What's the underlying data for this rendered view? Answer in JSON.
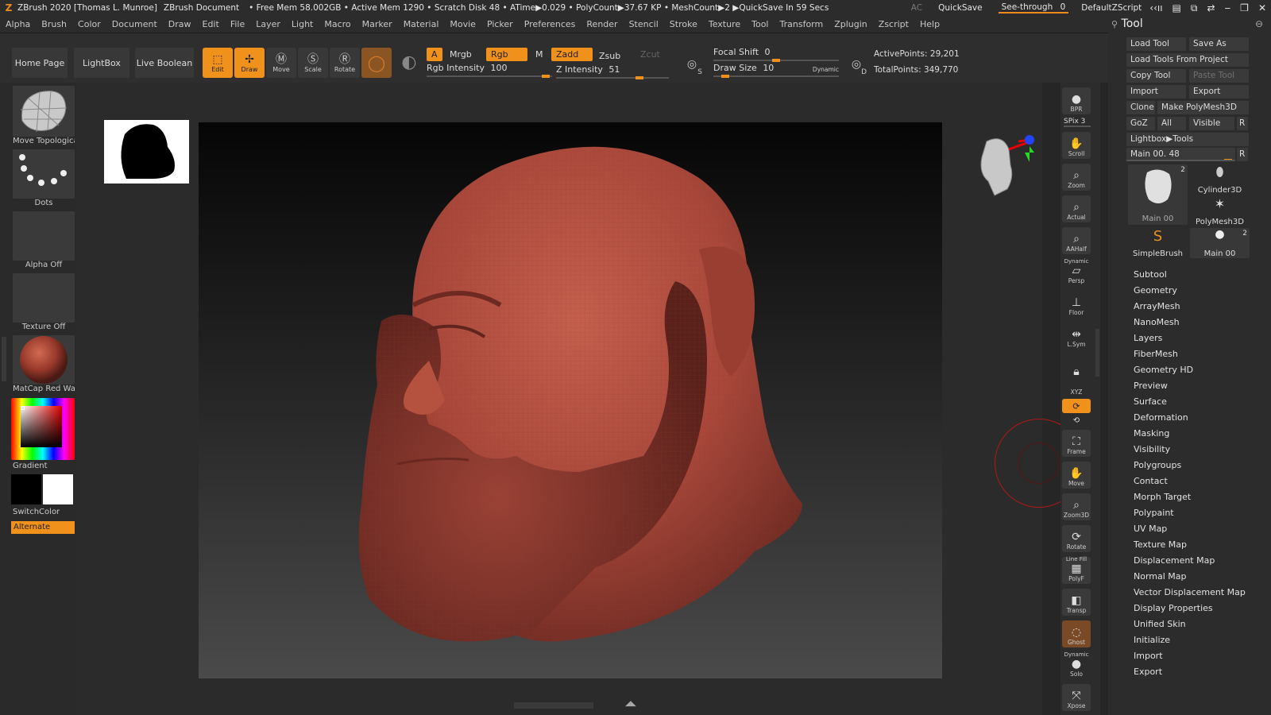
{
  "titlebar": {
    "app": "ZBrush 2020 [Thomas L. Munroe]",
    "doc": "ZBrush Document",
    "stats": "• Free Mem 58.002GB • Active Mem 1290 • Scratch Disk 48 • ATime▶0.029 • PolyCount▶37.67 KP • MeshCount▶2 ▶QuickSave In 59 Secs",
    "ac": "AC",
    "quicksave": "QuickSave",
    "seethrough": "See-through",
    "seethrough_value": "0",
    "script": "DefaultZScript"
  },
  "menu": [
    "Alpha",
    "Brush",
    "Color",
    "Document",
    "Draw",
    "Edit",
    "File",
    "Layer",
    "Light",
    "Macro",
    "Marker",
    "Material",
    "Movie",
    "Picker",
    "Preferences",
    "Render",
    "Stencil",
    "Stroke",
    "Texture",
    "Tool",
    "Transform",
    "Zplugin",
    "Zscript",
    "Help"
  ],
  "toolbar": {
    "home": "Home Page",
    "lightbox": "LightBox",
    "liveboolean": "Live Boolean",
    "edit": "Edit",
    "draw": "Draw",
    "move": "Move",
    "scale": "Scale",
    "rotate": "Rotate",
    "a": "A",
    "mrgb": "Mrgb",
    "rgb": "Rgb",
    "m": "M",
    "zadd": "Zadd",
    "zsub": "Zsub",
    "zcut": "Zcut",
    "rgb_intensity_label": "Rgb Intensity",
    "rgb_intensity": "100",
    "z_intensity_label": "Z Intensity",
    "z_intensity": "51",
    "focal_label": "Focal Shift",
    "focal": "0",
    "drawsize_label": "Draw Size",
    "drawsize": "10",
    "dynamic": "Dynamic",
    "s": "S",
    "d": "D",
    "active_points": "ActivePoints: 29,201",
    "total_points": "TotalPoints: 349,770"
  },
  "left": {
    "brush": "Move Topological",
    "stroke": "Dots",
    "alpha": "Alpha Off",
    "texture": "Texture Off",
    "material": "MatCap Red Wax",
    "gradient": "Gradient",
    "switchcolor": "SwitchColor",
    "alternate": "Alternate"
  },
  "rightstrip": {
    "bpr": "BPR",
    "spix": "SPix 3",
    "scroll": "Scroll",
    "zoom": "Zoom",
    "actual": "Actual",
    "aahalf": "AAHalf",
    "dynamic": "Dynamic",
    "persp": "Persp",
    "floor": "Floor",
    "lsym": "L.Sym",
    "xyz": "XYZ",
    "frame": "Frame",
    "move": "Move",
    "zoom3d": "Zoom3D",
    "rotate": "Rotate",
    "linefill": "Line Fill",
    "polyf": "PolyF",
    "transp": "Transp",
    "ghost": "Ghost",
    "dynamic2": "Dynamic",
    "solo": "Solo",
    "xpose": "Xpose"
  },
  "tool": {
    "title": "Tool",
    "load_tool": "Load Tool",
    "save_as": "Save As",
    "load_from_project": "Load Tools From Project",
    "copy_tool": "Copy Tool",
    "paste_tool": "Paste Tool",
    "import": "Import",
    "export": "Export",
    "clone": "Clone",
    "make_polymesh": "Make PolyMesh3D",
    "goz": "GoZ",
    "all": "All",
    "visible": "Visible",
    "r": "R",
    "lightbox_tools": "Lightbox▶Tools",
    "main_slider": "Main 00. 48",
    "thumbs": {
      "main": "Main 00",
      "main_count": "2",
      "cylinder": "Cylinder3D",
      "polymesh": "PolyMesh3D",
      "simplebrush": "SimpleBrush",
      "main2": "Main 00",
      "main2_count": "2"
    },
    "sections": [
      "Subtool",
      "Geometry",
      "ArrayMesh",
      "NanoMesh",
      "Layers",
      "FiberMesh",
      "Geometry HD",
      "Preview",
      "Surface",
      "Deformation",
      "Masking",
      "Visibility",
      "Polygroups",
      "Contact",
      "Morph Target",
      "Polypaint",
      "UV Map",
      "Texture Map",
      "Displacement Map",
      "Normal Map",
      "Vector Displacement Map",
      "Display Properties",
      "Unified Skin",
      "Initialize",
      "Import",
      "Export"
    ]
  },
  "colors": {
    "accent": "#f0911c",
    "clay": "#a8473a",
    "panel": "#2c2c2c"
  }
}
